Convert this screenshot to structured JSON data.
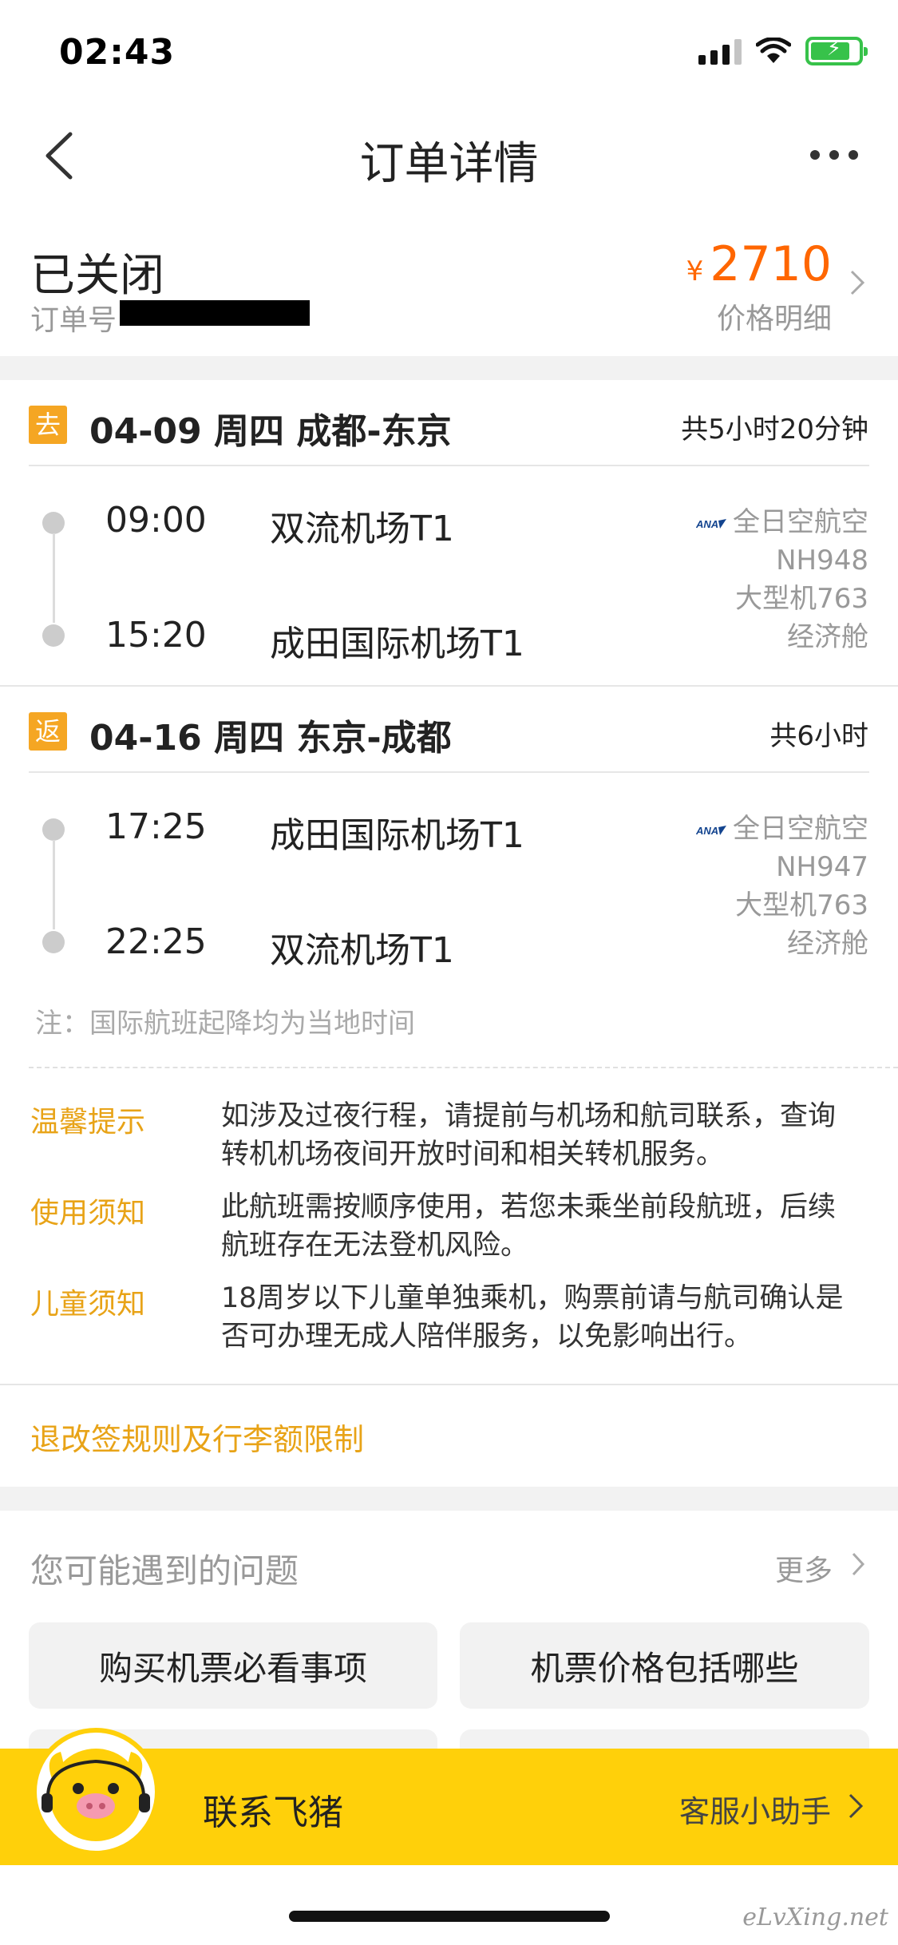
{
  "status_bar": {
    "time": "02:43"
  },
  "nav": {
    "title": "订单详情"
  },
  "order": {
    "status": "已关闭",
    "order_no_label": "订单号",
    "currency": "¥",
    "price": "2710",
    "price_detail_label": "价格明细"
  },
  "segments": [
    {
      "tag": "去",
      "title": "04-09 周四 成都-东京",
      "duration": "共5小时20分钟",
      "dep_time": "09:00",
      "dep_airport": "双流机场T1",
      "arr_time": "15:20",
      "arr_airport": "成田国际机场T1",
      "airline": "全日空航空",
      "flight_no": "NH948",
      "aircraft": "大型机763",
      "cabin": "经济舱"
    },
    {
      "tag": "返",
      "title": "04-16 周四 东京-成都",
      "duration": "共6小时",
      "dep_time": "17:25",
      "dep_airport": "成田国际机场T1",
      "arr_time": "22:25",
      "arr_airport": "双流机场T1",
      "airline": "全日空航空",
      "flight_no": "NH947",
      "aircraft": "大型机763",
      "cabin": "经济舱"
    }
  ],
  "note": "注：国际航班起降均为当地时间",
  "tips": [
    {
      "label": "温馨提示",
      "line1": "如涉及过夜行程，请提前与机场和航司联系，查询",
      "line2": "转机机场夜间开放时间和相关转机服务。"
    },
    {
      "label": "使用须知",
      "line1": "此航班需按顺序使用，若您未乘坐前段航班，后续",
      "line2": "航班存在无法登机风险。"
    },
    {
      "label": "儿童须知",
      "line1": "18周岁以下儿童单独乘机，购票前请与航司确认是",
      "line2": "否可办理无成人陪伴服务，以免影响出行。"
    }
  ],
  "rules_link": "退改签规则及行李额限制",
  "faq": {
    "title": "您可能遇到的问题",
    "more": "更多",
    "items": [
      "购买机票必看事项",
      "机票价格包括哪些"
    ]
  },
  "contact": {
    "label": "联系飞猪",
    "helper": "客服小助手"
  },
  "watermark": "eLvXing.net",
  "colors": {
    "accent": "#e8a317",
    "price": "#ff6600",
    "tag": "#f5a623",
    "contact_bar": "#ffd00a"
  },
  "icons": [
    "back-icon",
    "more-icon",
    "signal-icon",
    "wifi-icon",
    "battery-icon",
    "chevron-right-icon",
    "ana-logo-icon",
    "mascot-icon"
  ]
}
